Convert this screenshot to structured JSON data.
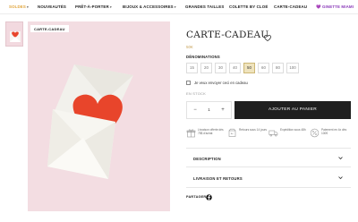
{
  "nav": {
    "items": [
      {
        "label": "SOLDES",
        "caret": true,
        "color": "#e0a43a"
      },
      {
        "label": "NOUVEAUTÉS",
        "caret": false
      },
      {
        "label": "PRÊT-À-PORTER",
        "caret": true
      },
      {
        "label": "BIJOUX & ACCESSOIRES",
        "caret": true
      },
      {
        "label": "GRANDES TAILLES",
        "caret": false
      },
      {
        "label": "COLETTE BY CLOÉ",
        "caret": false
      },
      {
        "label": "CARTE-CADEAU",
        "caret": false
      },
      {
        "label": "💜 GINETTE MIAMI",
        "caret": false,
        "color": "#8a3ab9"
      }
    ]
  },
  "gallery": {
    "badge": "CARTE-CADEAU",
    "background": "#f3dde2",
    "heart_color": "#e8452b"
  },
  "product": {
    "title": "CARTE-CADEAU",
    "price": "50€",
    "denominations_label": "DÉNOMINATIONS",
    "denominations": [
      "15",
      "20",
      "30",
      "40",
      "50",
      "60",
      "80",
      "100"
    ],
    "selected_denomination": "50",
    "gift_checkbox_label": "Je veux envoyer ceci en cadeau",
    "stock": "EN STOCK",
    "quantity": "1",
    "qty_minus": "−",
    "qty_plus": "+",
    "add_to_cart": "AJOUTER AU PANIER",
    "features": [
      {
        "icon": "gift-box-icon",
        "text": "Livraison offerte dès 75$ d'achat"
      },
      {
        "icon": "return-box-icon",
        "text": "Retours sous 14 jours"
      },
      {
        "icon": "delivery-truck-icon",
        "text": "Expédition sous 48h"
      },
      {
        "icon": "percent-badge-icon",
        "text": "Paiement en 4x dès 100€"
      }
    ],
    "description_label": "DESCRIPTION",
    "shipping_label": "LIVRAISON ET RETOURS",
    "share_label": "PARTAGER",
    "accent": "#efe3bd",
    "button_color": "#1f1f1f"
  }
}
